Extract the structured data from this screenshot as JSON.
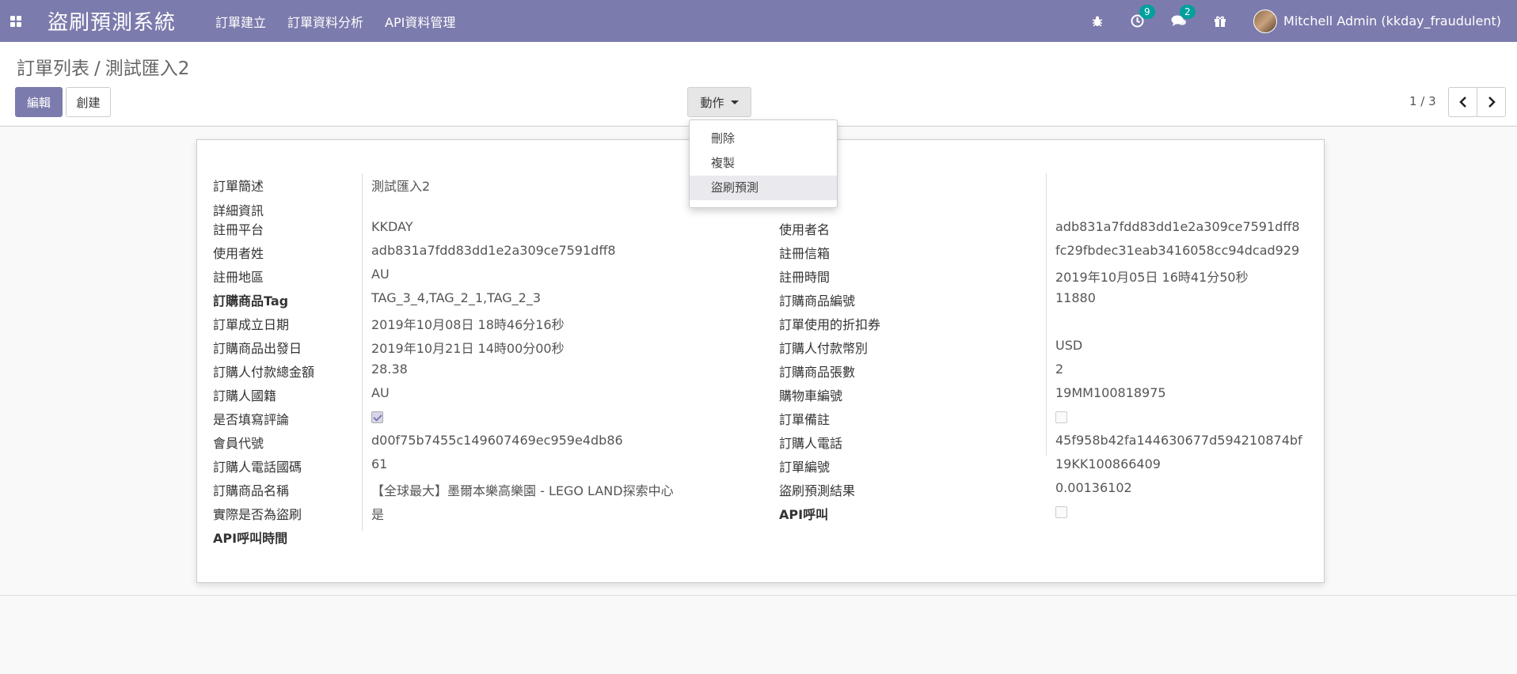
{
  "navbar": {
    "brand": "盜刷預測系統",
    "menu": [
      "訂單建立",
      "訂單資料分析",
      "API資料管理"
    ],
    "activity_badge": "9",
    "message_badge": "2",
    "user": "Mitchell Admin (kkday_fraudulent)"
  },
  "control": {
    "breadcrumb_parent": "訂單列表",
    "breadcrumb_sep": "/",
    "breadcrumb_current": "測試匯入2",
    "edit_label": "編輯",
    "create_label": "創建",
    "action_label": "動作",
    "pager": "1 / 3"
  },
  "dropdown": [
    "刪除",
    "複製",
    "盜刷預測"
  ],
  "form": {
    "left": [
      {
        "label": "訂單簡述",
        "value": "測試匯入2"
      },
      {
        "label": "詳細資訊",
        "value": ""
      },
      {
        "label": "註冊平台",
        "value": "KKDAY"
      },
      {
        "label": "使用者姓",
        "value": "adb831a7fdd83dd1e2a309ce7591dff8"
      },
      {
        "label": "註冊地區",
        "value": "AU"
      },
      {
        "label": "訂購商品Tag",
        "value": "TAG_3_4,TAG_2_1,TAG_2_3"
      },
      {
        "label": "訂單成立日期",
        "value": "2019年10月08日 18時46分16秒"
      },
      {
        "label": "訂購商品出發日",
        "value": "2019年10月21日 14時00分00秒"
      },
      {
        "label": "訂購人付款總金額",
        "value": "28.38"
      },
      {
        "label": "訂購人國籍",
        "value": "AU"
      },
      {
        "label": "是否填寫評論",
        "value": ""
      },
      {
        "label": "會員代號",
        "value": "d00f75b7455c149607469ec959e4db86"
      },
      {
        "label": "訂購人電話國碼",
        "value": "61"
      },
      {
        "label": "訂購商品名稱",
        "value": "【全球最大】墨爾本樂高樂園 - LEGO LAND探索中心"
      },
      {
        "label": "實際是否為盜刷",
        "value": "是"
      },
      {
        "label": "API呼叫時間",
        "value": ""
      }
    ],
    "right": [
      {
        "label": "使用者名",
        "value": "adb831a7fdd83dd1e2a309ce7591dff8"
      },
      {
        "label": "註冊信箱",
        "value": "fc29fbdec31eab3416058cc94dcad929"
      },
      {
        "label": "註冊時間",
        "value": "2019年10月05日 16時41分50秒"
      },
      {
        "label": "訂購商品編號",
        "value": "11880"
      },
      {
        "label": "訂單使用的折扣券",
        "value": ""
      },
      {
        "label": "訂購人付款幣別",
        "value": "USD"
      },
      {
        "label": "訂購商品張數",
        "value": "2"
      },
      {
        "label": "購物車編號",
        "value": "19MM100818975"
      },
      {
        "label": "訂單備註",
        "value": ""
      },
      {
        "label": "訂購人電話",
        "value": "45f958b42fa144630677d594210874bf"
      },
      {
        "label": "訂單編號",
        "value": "19KK100866409"
      },
      {
        "label": "盜刷預測結果",
        "value": "0.00136102"
      },
      {
        "label": "API呼叫",
        "value": ""
      }
    ]
  }
}
